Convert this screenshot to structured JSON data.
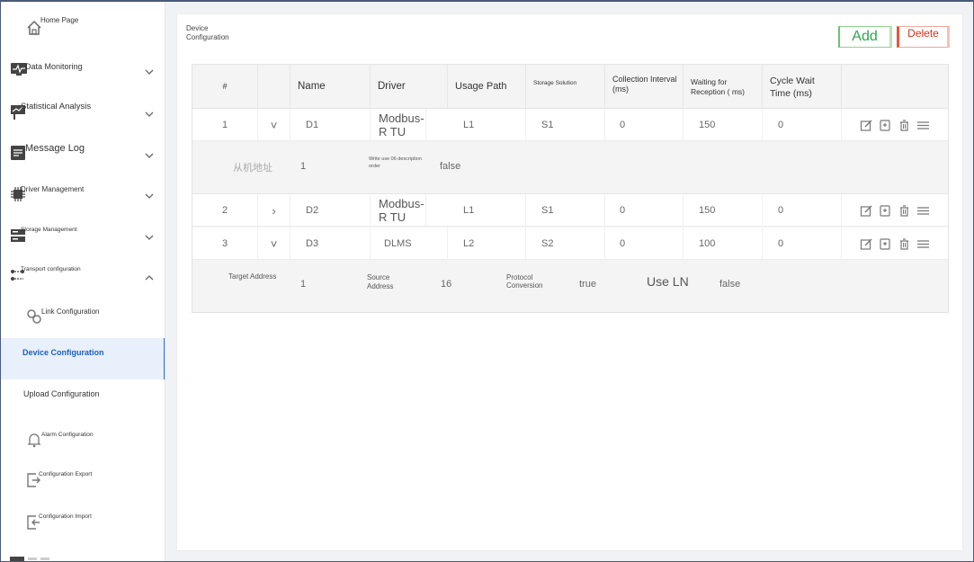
{
  "sidebar": {
    "items": [
      {
        "label": "Home Page",
        "icon": "home-icon"
      },
      {
        "label": "Data Monitoring",
        "icon": "monitor-icon"
      },
      {
        "label": "Statistical Analysis",
        "icon": "chart-icon"
      },
      {
        "label": "Message Log",
        "icon": "log-icon"
      },
      {
        "label": "Driver Management",
        "icon": "chip-icon"
      },
      {
        "label": "Storage Management",
        "icon": "storage-icon"
      },
      {
        "label": "Transport configuration",
        "icon": "transport-icon"
      },
      {
        "label": "Link Configuration",
        "icon": "link-icon"
      },
      {
        "label": "Device Configuration",
        "icon": ""
      },
      {
        "label": "Upload Configuration",
        "icon": ""
      },
      {
        "label": "Alarm Configuration",
        "icon": "bell-icon"
      },
      {
        "label": "Configuration Export",
        "icon": "export-icon"
      },
      {
        "label": "Configuration Import",
        "icon": "import-icon"
      }
    ]
  },
  "header": {
    "title": "Device Configuration",
    "add_label": "Add",
    "delete_label": "Delete"
  },
  "table": {
    "columns": [
      "#",
      "",
      "Name",
      "Driver",
      "Usage Path",
      "Storage Solution",
      "Collection Interval (ms)",
      "Waiting for Reception ( ms)",
      "Cycle Wait Time (ms)",
      ""
    ],
    "rows": [
      {
        "index": "1",
        "expand": "˅",
        "name": "D1",
        "driver": "Modbus-R TU",
        "path": "L1",
        "storage": "S1",
        "interval": "0",
        "wait": "150",
        "cycle": "0"
      },
      {
        "index": "2",
        "expand": "›",
        "name": "D2",
        "driver": "Modbus-R TU",
        "path": "L1",
        "storage": "S1",
        "interval": "0",
        "wait": "150",
        "cycle": "0"
      },
      {
        "index": "3",
        "expand": "˅",
        "name": "D3",
        "driver": "DLMS",
        "path": "L2",
        "storage": "S2",
        "interval": "0",
        "wait": "100",
        "cycle": "0"
      }
    ],
    "detail1": {
      "slave_label": "从机地址",
      "slave_value": "1",
      "write_label": "Write use 06 description order",
      "write_value": "false"
    },
    "detail3": {
      "target_label": "Target Address",
      "target_value": "1",
      "source_label": "Source Address",
      "source_value": "16",
      "protocol_label": "Protocol Conversion",
      "protocol_value": "true",
      "useln_label": "Use LN",
      "useln_value": "false"
    }
  },
  "colors": {
    "accent": "#1f5fb8",
    "add": "#2ea44f",
    "delete": "#d9301c"
  }
}
